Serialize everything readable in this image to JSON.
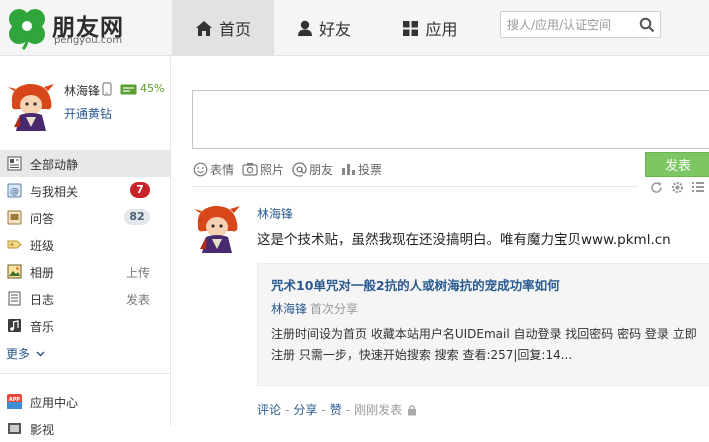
{
  "header": {
    "logo_text": "朋友网",
    "logo_sub": "pengyou.com",
    "nav": {
      "home": "首页",
      "friends": "好友",
      "apps": "应用"
    },
    "search_placeholder": "搜人/应用/认证空间"
  },
  "profile": {
    "name": "林海锋",
    "vip_percent": "45%",
    "vip_link": "开通黄钻"
  },
  "sidebar": {
    "items": [
      {
        "label": "全部动静",
        "icon": "feed-icon"
      },
      {
        "label": "与我相关",
        "icon": "mention-icon",
        "badge": "7"
      },
      {
        "label": "问答",
        "icon": "qa-icon",
        "badge": "82"
      },
      {
        "label": "班级",
        "icon": "class-icon"
      },
      {
        "label": "相册",
        "icon": "album-icon",
        "right": "上传"
      },
      {
        "label": "日志",
        "icon": "blog-icon",
        "right": "发表"
      },
      {
        "label": "音乐",
        "icon": "music-icon"
      }
    ],
    "more": "更多",
    "items2": [
      {
        "label": "应用中心",
        "icon": "app-center-icon"
      },
      {
        "label": "影视",
        "icon": "video-icon"
      }
    ]
  },
  "composer": {
    "tools": {
      "emoji": "表情",
      "photo": "照片",
      "friend": "朋友",
      "vote": "投票"
    },
    "post_button": "发表"
  },
  "post": {
    "author": "林海锋",
    "text": "这是个技术贴，虽然我现在还没搞明白。唯有魔力宝贝www.pkml.cn",
    "share": {
      "title": "咒术10单咒对一般2抗的人或树海抗的宠成功率如何",
      "author": "林海锋",
      "first_share": "首次分享",
      "body": "注册时间设为首页 收藏本站用户名UIDEmail 自动登录 找回密码 密码 登录 立即注册 只需一步，快速开始搜索 搜索 查看:257|回复:14..."
    },
    "actions": {
      "comment": "评论",
      "share": "分享",
      "like": "赞",
      "time": "刚刚发表"
    }
  },
  "colors": {
    "link": "#2a5a8f",
    "post_button": "#7cc663",
    "badge_red": "#c8222a",
    "logo_green": "#2fa53c"
  }
}
